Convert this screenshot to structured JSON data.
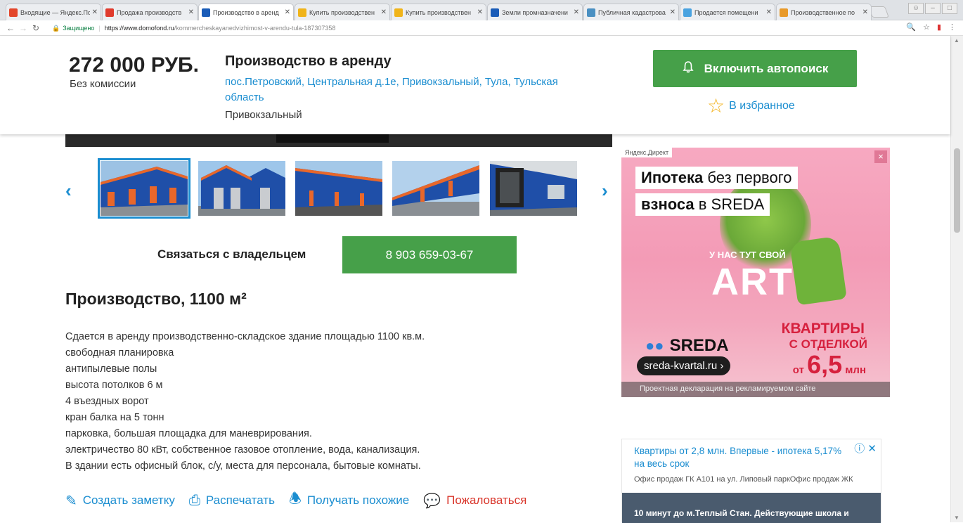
{
  "browser": {
    "tabs": [
      {
        "title": "Входящие — Яндекс.По",
        "favicon_color": "#e3462b",
        "icon": "mail-icon"
      },
      {
        "title": "Продажа производств",
        "favicon_color": "#e03b2d",
        "icon": "yandex-icon"
      },
      {
        "title": "Производство в аренд",
        "favicon_color": "#1a5cb8",
        "icon": "domofond-icon",
        "active": true
      },
      {
        "title": "Купить производствен",
        "favicon_color": "#f0b41a",
        "icon": "listing-icon"
      },
      {
        "title": "Купить производствен",
        "favicon_color": "#f0b41a",
        "icon": "listing-icon"
      },
      {
        "title": "Земли промназначени",
        "favicon_color": "#1a5cb8",
        "icon": "domofond-icon"
      },
      {
        "title": "Публичная кадастрова",
        "favicon_color": "#4a90c2",
        "icon": "cadastre-icon"
      },
      {
        "title": "Продается помещени",
        "favicon_color": "#4aa3e0",
        "icon": "pin-icon"
      },
      {
        "title": "Производственное по",
        "favicon_color": "#e89a2a",
        "icon": "listing-icon"
      }
    ],
    "secure_label": "Защищено",
    "url_domain": "https://www.domofond.ru",
    "url_path": "/kommercheskayanedvizhimost-v-arendu-tula-187307358"
  },
  "listing": {
    "price": "272 000 РУБ.",
    "commission": "Без комиссии",
    "title": "Производство в аренду",
    "address": "пос.Петровский, Центральная д.1е, Привокзальный, Тула, Тульская область",
    "district": "Привокзальный",
    "autosearch_label": "Включить автопоиск",
    "favorite_label": "В избранное",
    "contact_label": "Связаться с владельцем",
    "phone": "8 903 659-03-67",
    "heading": "Производство, 1100 м²",
    "description": [
      "Сдается в аренду производственно-складское здание площадью 1100 кв.м.",
      "свободная планировка",
      "антипылевые полы",
      "высота потолков 6 м",
      "4 въездных ворот",
      "кран балка на 5 тонн",
      "парковка, большая площадка для маневрирования.",
      "электричество 80 кВт, собственное газовое отопление, вода, канализация.",
      "В здании есть офисный блок, с/у, места для персонала, бытовые комнаты."
    ],
    "actions": {
      "note": "Создать заметку",
      "print": "Распечатать",
      "similar": "Получать похожие",
      "report": "Пожаловаться"
    }
  },
  "ad_banner": {
    "label": "Яндекс.Директ",
    "headline_1_bold": "Ипотека",
    "headline_1_rest": " без первого",
    "headline_2_bold": "взноса",
    "headline_2_rest": " в SREDA",
    "tagline": "У НАС ТУТ СВОЙ",
    "art": "ART",
    "offer_1": "КВАРТИРЫ",
    "offer_2": "С ОТДЕЛКОЙ",
    "offer_from": "от",
    "offer_price": "6,5",
    "offer_unit": "млн",
    "brand": "SREDA",
    "site": "sreda-kvartal.ru ›",
    "disclaimer": "Проектная декларация на рекламируемом сайте"
  },
  "text_ad": {
    "title": "Квартиры от 2,8 млн. Впервые - ипотека 5,17% на весь срок",
    "subtitle": "Офис продаж ГК А101 на ул. Липовый паркОфис продаж ЖК",
    "teaser": "10 минут до м.Теплый Стан. Действующие школа и"
  },
  "colors": {
    "accent": "#1a8dd0",
    "green": "#46a049",
    "report_red": "#d9362b"
  }
}
